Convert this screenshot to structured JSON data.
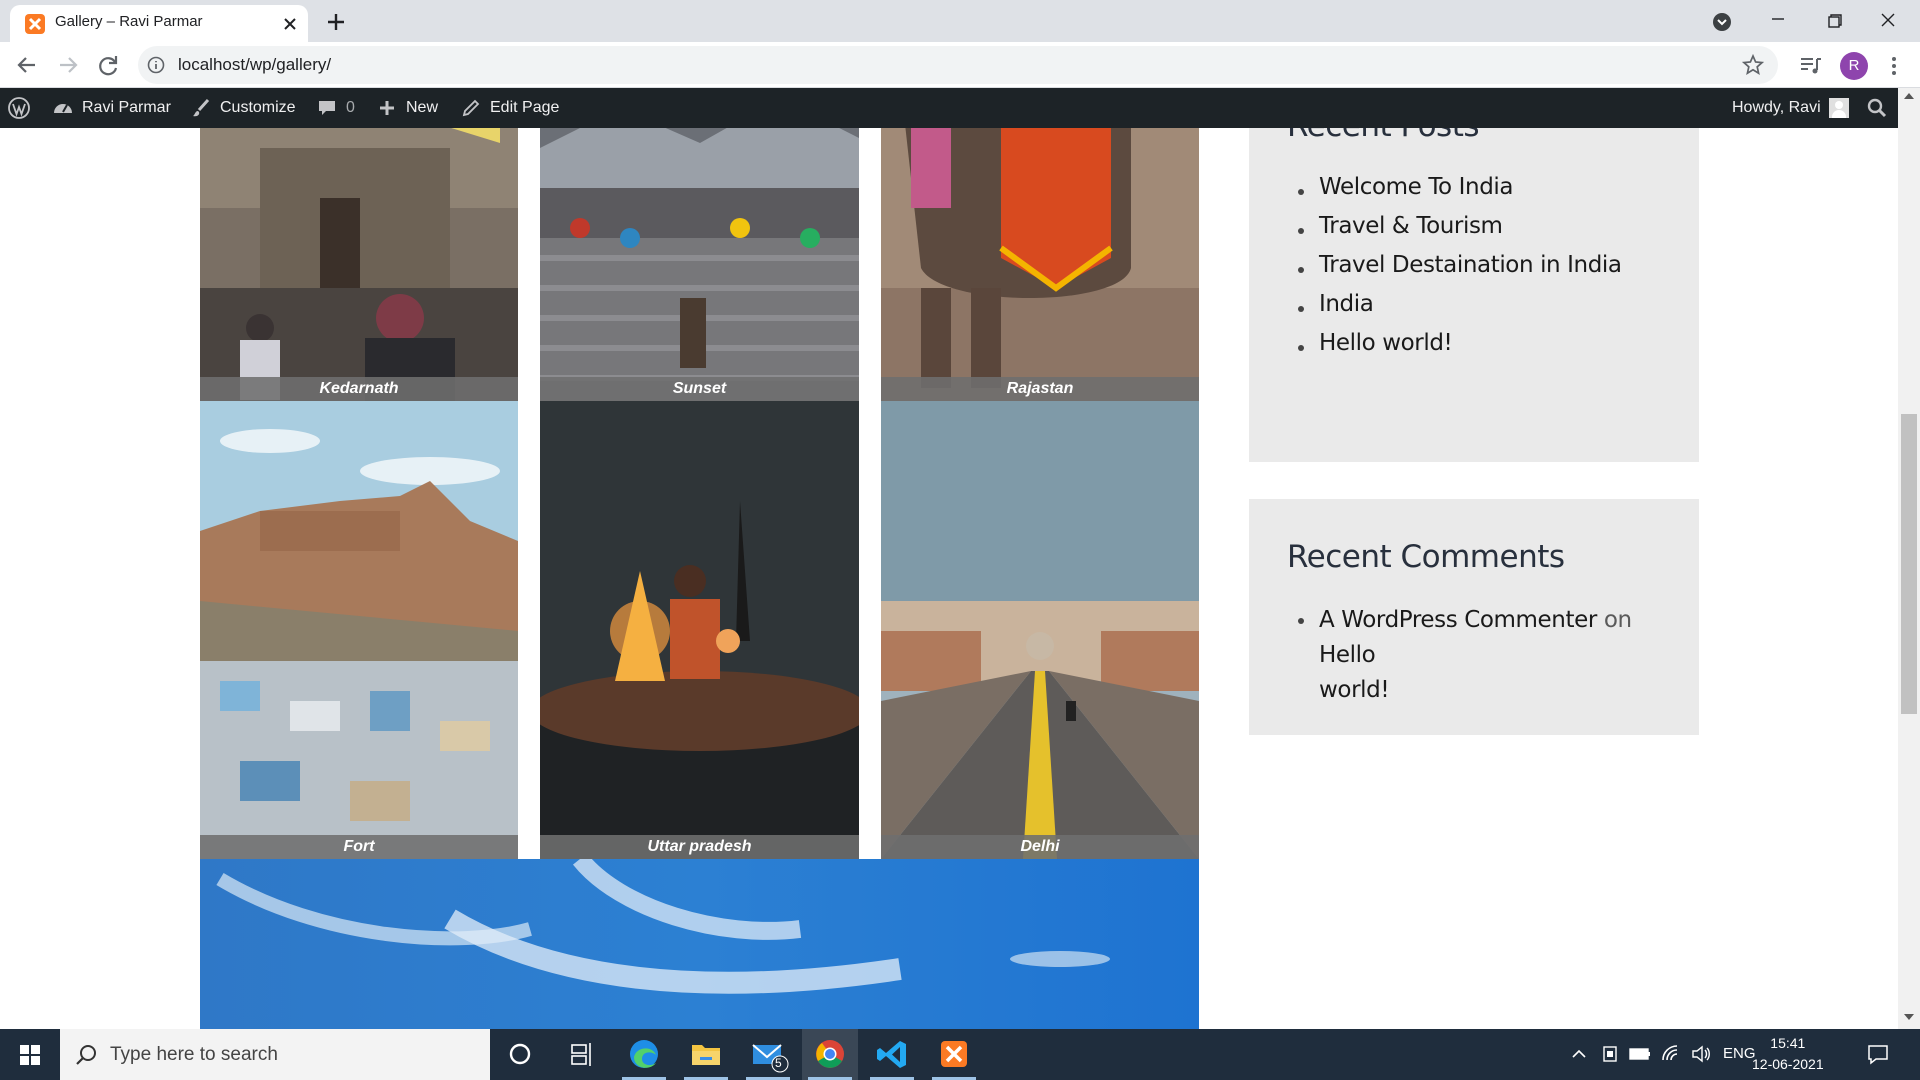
{
  "browser": {
    "tab_title": "Gallery – Ravi Parmar",
    "url": "localhost/wp/gallery/",
    "profile_initial": "R"
  },
  "wp_admin_bar": {
    "site_name": "Ravi Parmar",
    "customize": "Customize",
    "comments_count": "0",
    "new": "New",
    "edit_page": "Edit Page",
    "howdy": "Howdy, Ravi"
  },
  "gallery": {
    "items": [
      {
        "caption": "Kedarnath"
      },
      {
        "caption": "Sunset"
      },
      {
        "caption": "Rajastan"
      },
      {
        "caption": "Fort"
      },
      {
        "caption": "Uttar pradesh"
      },
      {
        "caption": "Delhi"
      }
    ]
  },
  "sidebar": {
    "recent_posts": {
      "title": "Recent Posts",
      "items": [
        "Welcome To India",
        "Travel & Tourism",
        "Travel Destaination in India",
        "India",
        "Hello world!"
      ]
    },
    "recent_comments": {
      "title": "Recent Comments",
      "author": "A WordPress Commenter",
      "connector": "on",
      "post_line1": "Hello",
      "post_line2": "world!"
    }
  },
  "taskbar": {
    "search_placeholder": "Type here to search",
    "mail_badge": "5",
    "language": "ENG",
    "time": "15:41",
    "date": "12-06-2021"
  },
  "colors": {
    "wp_bar": "#1d2327",
    "widget_bg": "#eaeaea",
    "taskbar": "#1f2d3d",
    "xampp_orange": "#fb7a24"
  }
}
